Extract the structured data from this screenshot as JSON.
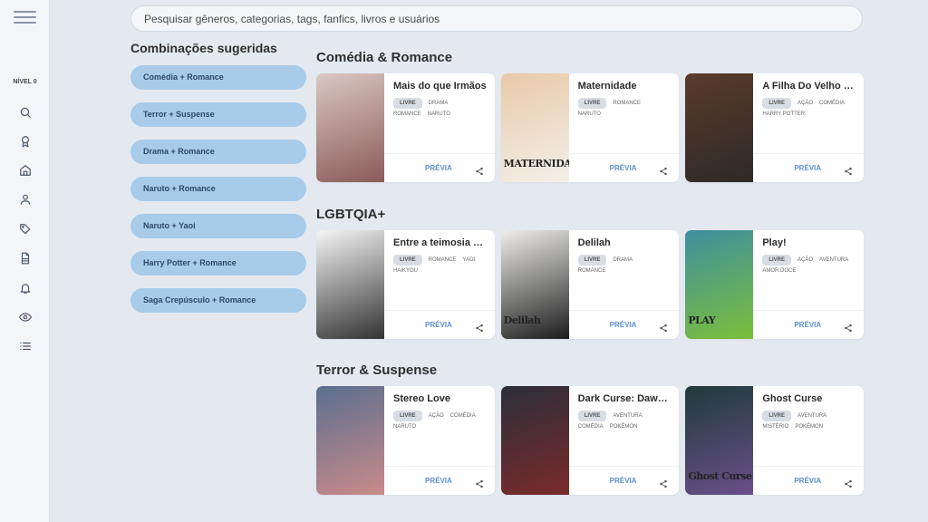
{
  "sidebar": {
    "level_label": "NÍVEL 0",
    "icons": [
      "search-icon",
      "badge-icon",
      "home-icon",
      "user-icon",
      "tag-icon",
      "document-icon",
      "bell-icon",
      "eye-icon",
      "list-icon"
    ]
  },
  "search": {
    "placeholder": "Pesquisar gêneros, categorias, tags, fanfics, livros e usuários"
  },
  "combos": {
    "title": "Combinações sugeridas",
    "items": [
      "Comédia + Romance",
      "Terror + Suspense",
      "Drama + Romance",
      "Naruto + Romance",
      "Naruto + Yaoi",
      "Harry Potter + Romance",
      "Saga Crepúsculo + Romance"
    ]
  },
  "sections": [
    {
      "title": "Comédia & Romance",
      "cards": [
        {
          "title": "Mais do que Irmãos",
          "badge": "LIVRE",
          "tags": [
            "DRAMA",
            "ROMANCE",
            "NARUTO"
          ],
          "cover_text": "",
          "preview": "PRÉVIA",
          "colors": [
            "#d9c8c2",
            "#8b5a5a"
          ]
        },
        {
          "title": "Maternidade",
          "badge": "LIVRE",
          "tags": [
            "ROMANCE",
            "NARUTO"
          ],
          "cover_text": "MATERNIDADE",
          "preview": "PRÉVIA",
          "colors": [
            "#e8c9a8",
            "#f3f0ea"
          ]
        },
        {
          "title": "A Filha Do Velho M...",
          "badge": "LIVRE",
          "tags": [
            "AÇÃO",
            "COMÉDIA",
            "HARRY POTTER"
          ],
          "cover_text": "",
          "preview": "PRÉVIA",
          "colors": [
            "#5a3b2c",
            "#2d2a28"
          ]
        }
      ]
    },
    {
      "title": "LGBTQIA+",
      "cards": [
        {
          "title": "Entre a teimosia e a...",
          "badge": "LIVRE",
          "tags": [
            "ROMANCE",
            "YAOI",
            "HAIKYOU"
          ],
          "cover_text": "",
          "preview": "PRÉVIA",
          "colors": [
            "#f5f5f5",
            "#333333"
          ]
        },
        {
          "title": "Delilah",
          "badge": "LIVRE",
          "tags": [
            "DRAMA",
            "ROMANCE"
          ],
          "cover_text": "Delilah",
          "preview": "PRÉVIA",
          "colors": [
            "#efeeec",
            "#1c1c1c"
          ]
        },
        {
          "title": "Play!",
          "badge": "LIVRE",
          "tags": [
            "AÇÃO",
            "AVENTURA",
            "AMOR DOCE"
          ],
          "cover_text": "PLAY",
          "preview": "PRÉVIA",
          "colors": [
            "#3d8fa0",
            "#7bbf3a"
          ]
        }
      ]
    },
    {
      "title": "Terror & Suspense",
      "cards": [
        {
          "title": "Stereo Love",
          "badge": "LIVRE",
          "tags": [
            "AÇÃO",
            "COMÉDIA",
            "NARUTO"
          ],
          "cover_text": "",
          "preview": "PRÉVIA",
          "colors": [
            "#5b6f8f",
            "#c98a8a"
          ]
        },
        {
          "title": "Dark Curse: Dawn O...",
          "badge": "LIVRE",
          "tags": [
            "AVENTURA",
            "COMÉDIA",
            "POKÉMON"
          ],
          "cover_text": "",
          "preview": "PRÉVIA",
          "colors": [
            "#2b2e3a",
            "#7a2b2b"
          ]
        },
        {
          "title": "Ghost Curse",
          "badge": "LIVRE",
          "tags": [
            "AVENTURA",
            "MISTÉRIO",
            "POKÉMON"
          ],
          "cover_text": "Ghost Curse",
          "preview": "PRÉVIA",
          "colors": [
            "#1f3b3a",
            "#6b4f8a"
          ]
        }
      ]
    }
  ]
}
